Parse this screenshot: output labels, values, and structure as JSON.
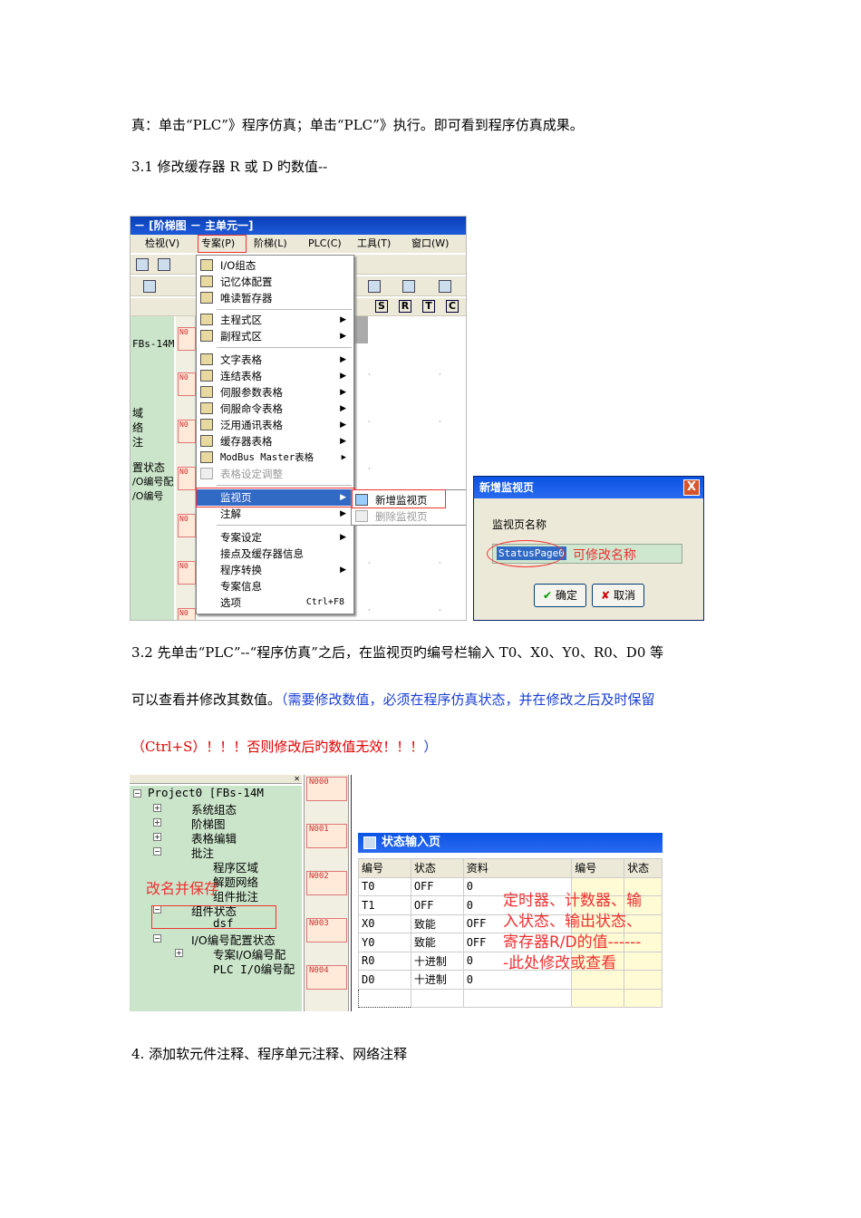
{
  "doc": {
    "line1": "真：单击“PLC”》程序仿真；单击“PLC”》执行。即可看到程序仿真成果。",
    "heading31": "3.1 修改缓存器 R 或 D 旳数值--",
    "para32_line1": "3.2 先单击“PLC”--“程序仿真”之后，在监视页旳编号栏输入 T0、X0、Y0、R0、D0 等",
    "para32_line2_black": "可以查看并修改其数值。",
    "para32_line2_blue": "（需要修改数值，必须在程序仿真状态，并在修改之后及时保留",
    "para32_line3_red": "（Ctrl+S）！！！否则修改后旳数值无效！！！",
    "para32_line3_blue": "）",
    "heading4": "4. 添加软元件注释、程序单元注释、网络注释"
  },
  "shot1": {
    "title": "－ [阶梯图 － 主单元一]",
    "menubar": [
      "检视(V)",
      "专案(P)",
      "阶梯(L)",
      "PLC(C)",
      "工具(T)",
      "窗口(W)"
    ],
    "left_labels": [
      "FBs-14M",
      "域",
      "络",
      "注",
      "置状态",
      "/O编号配",
      "/O编号"
    ],
    "n_labels": [
      "N0",
      "N0",
      "N0",
      "N0",
      "N0",
      "N0",
      "N0"
    ],
    "toolbar_letters": [
      "S",
      "R",
      "T",
      "C"
    ],
    "menu_items": [
      {
        "label": "I/O组态"
      },
      {
        "label": "记忆体配置"
      },
      {
        "label": "唯读暂存器"
      },
      {
        "label": "主程式区"
      },
      {
        "label": "副程式区"
      },
      {
        "label": "文字表格"
      },
      {
        "label": "连结表格"
      },
      {
        "label": "伺服参数表格"
      },
      {
        "label": "伺服命令表格"
      },
      {
        "label": "泛用通讯表格"
      },
      {
        "label": "缓存器表格"
      },
      {
        "label": "ModBus Master表格"
      },
      {
        "label": "表格设定调整"
      },
      {
        "label": "监视页"
      },
      {
        "label": "注解"
      },
      {
        "label": "专案设定"
      },
      {
        "label": "接点及缓存器信息"
      },
      {
        "label": "程序转换"
      },
      {
        "label": "专案信息"
      },
      {
        "label": "选项",
        "shortcut": "Ctrl+F8"
      }
    ],
    "submenu": [
      "新增监视页",
      "删除监视页"
    ]
  },
  "dialog": {
    "title": "新增监视页",
    "close": "X",
    "label": "监视页名称",
    "value": "StatusPage0",
    "annotation": "可修改名称",
    "ok": "确定",
    "cancel": "取消"
  },
  "shot2": {
    "tree": [
      "Project0 [FBs-14M",
      "系统组态",
      "阶梯图",
      "表格编辑",
      "批注",
      "程序区域",
      "解题网络",
      "组件批注",
      "组件状态",
      "dsf",
      "I/O编号配置状态",
      "专案I/O编号配",
      "PLC I/O编号配"
    ],
    "tree_annotation": "改名并保存",
    "n_labels": [
      "N000",
      "N001",
      "N002",
      "N003",
      "N004"
    ],
    "window_title": "状态输入页",
    "headers": [
      "编号",
      "状态",
      "资料",
      "编号",
      "状态"
    ],
    "rows": [
      [
        "T0",
        "OFF",
        "0"
      ],
      [
        "T1",
        "OFF",
        "0"
      ],
      [
        "X0",
        "致能",
        "OFF"
      ],
      [
        "Y0",
        "致能",
        "OFF"
      ],
      [
        "R0",
        "十进制",
        "0"
      ],
      [
        "D0",
        "十进制",
        "0"
      ]
    ],
    "annotation_lines": [
      "定时器、计数器、输",
      "入状态、输出状态、",
      "寄存器R/D的值------",
      "-此处修改或查看"
    ]
  },
  "colors": {
    "blue_text": "#1a3fd6",
    "red_text": "#e00000",
    "titlebar": "#0a3fb8",
    "tree_bg": "#cbe5cb",
    "annotation_red": "#f03030"
  }
}
